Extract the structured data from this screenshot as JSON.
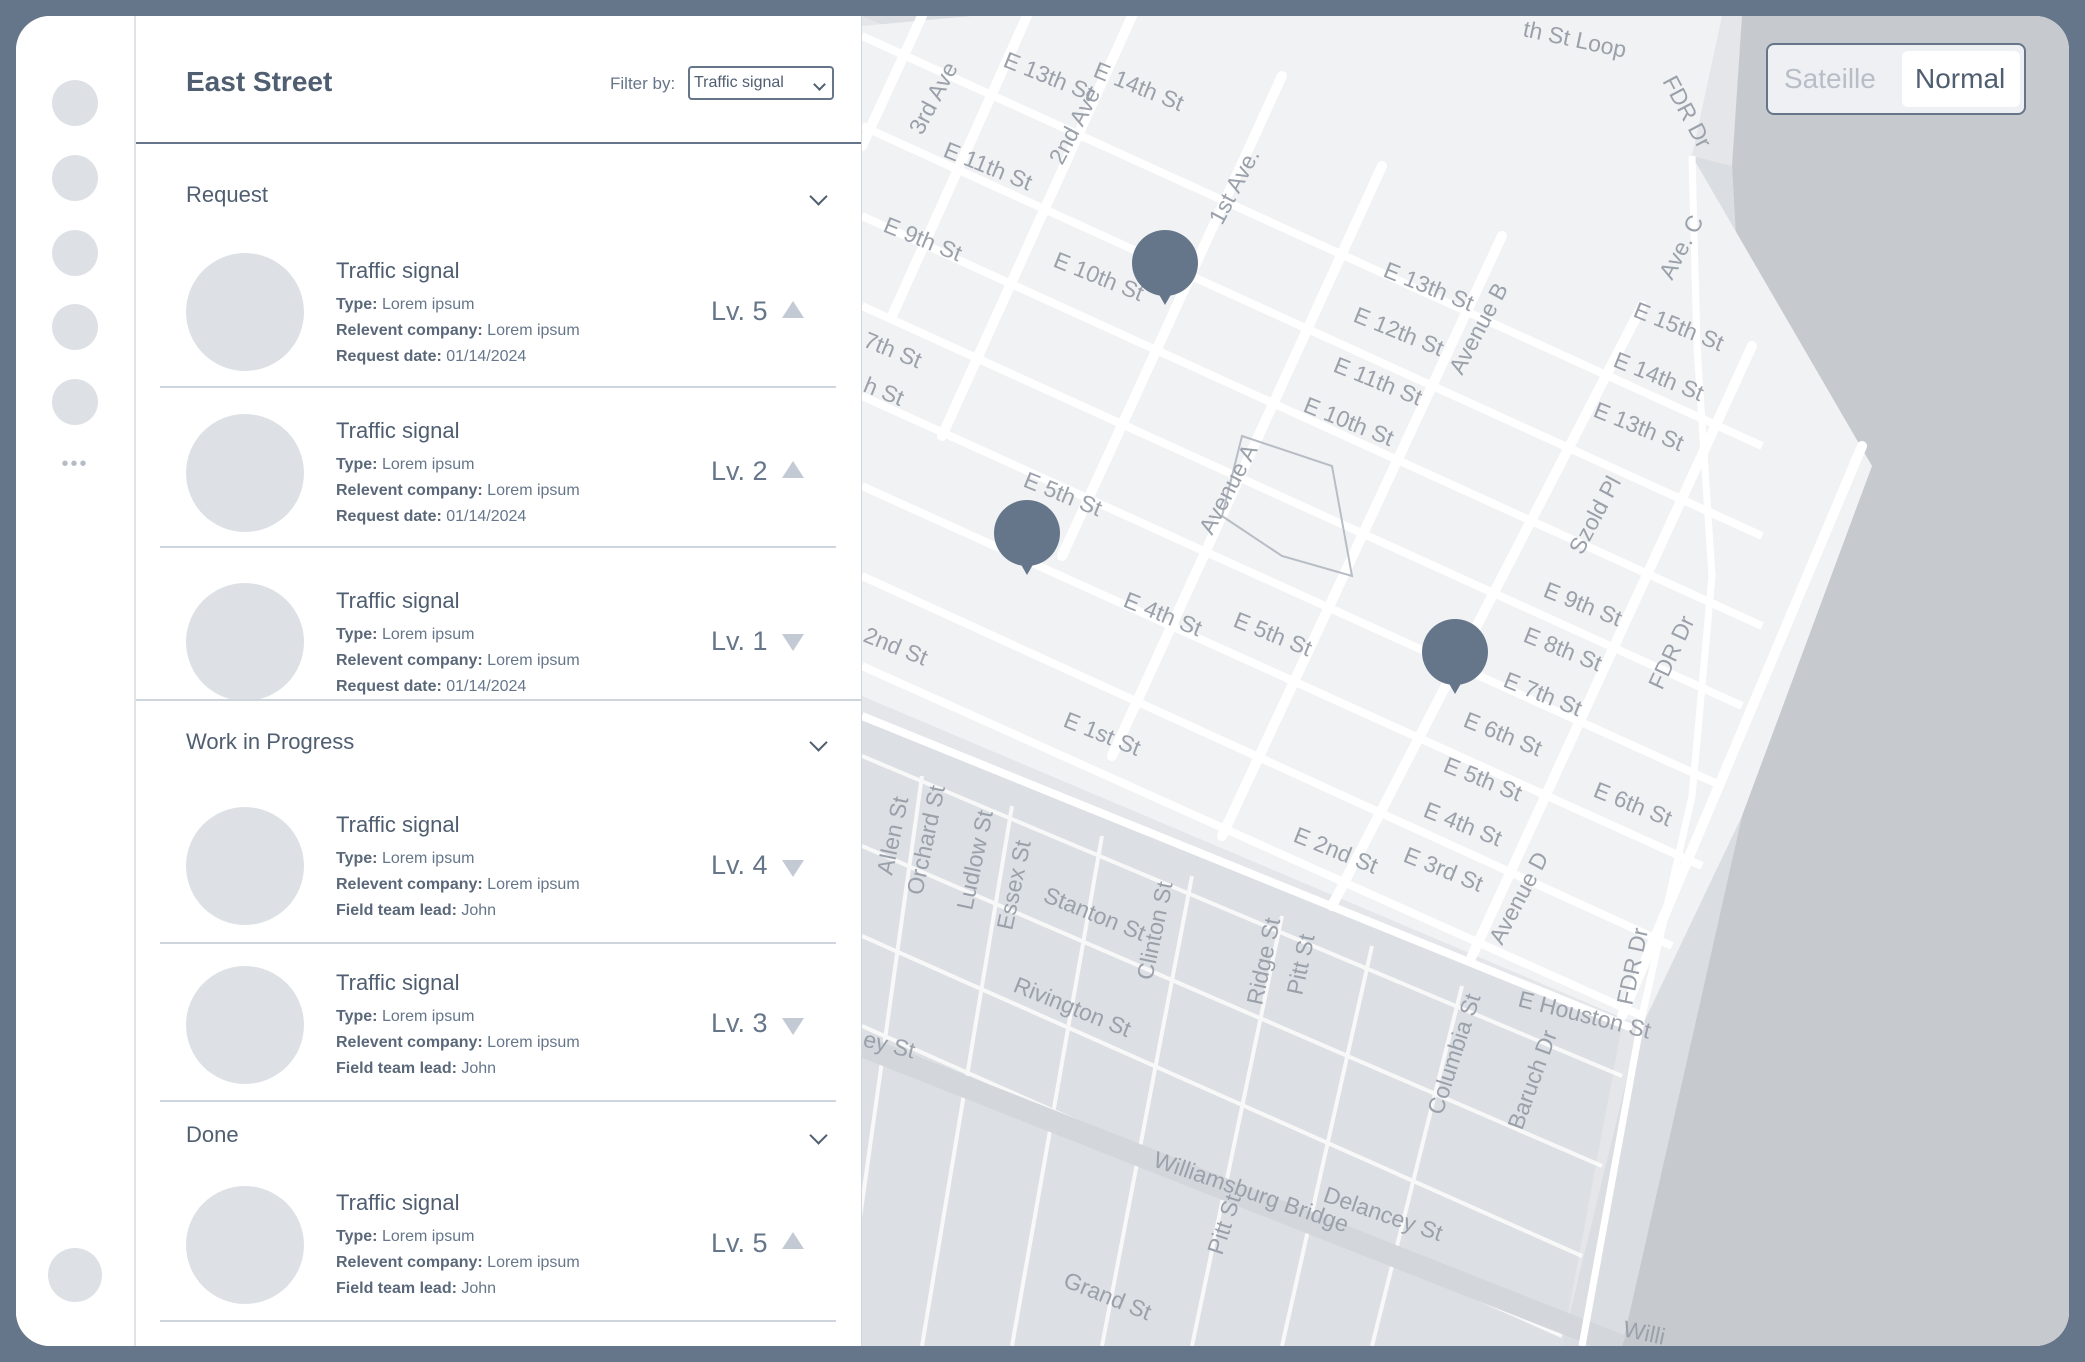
{
  "header": {
    "title": "East Street",
    "filter_label": "Filter by:",
    "filter_value": "Traffic signal"
  },
  "sections": [
    {
      "title": "Request",
      "items": [
        {
          "title": "Traffic signal",
          "type_label": "Type:",
          "type_value": "Lorem ipsum",
          "company_label": "Relevent company:",
          "company_value": "Lorem ipsum",
          "extra_label": "Request date:",
          "extra_value": "01/14/2024",
          "level": "Lv. 5",
          "trend": "up"
        },
        {
          "title": "Traffic signal",
          "type_label": "Type:",
          "type_value": "Lorem ipsum",
          "company_label": "Relevent company:",
          "company_value": "Lorem ipsum",
          "extra_label": "Request date:",
          "extra_value": "01/14/2024",
          "level": "Lv. 2",
          "trend": "up"
        },
        {
          "title": "Traffic signal",
          "type_label": "Type:",
          "type_value": "Lorem ipsum",
          "company_label": "Relevent company:",
          "company_value": "Lorem ipsum",
          "extra_label": "Request date:",
          "extra_value": "01/14/2024",
          "level": "Lv. 1",
          "trend": "down"
        }
      ]
    },
    {
      "title": "Work in Progress",
      "items": [
        {
          "title": "Traffic signal",
          "type_label": "Type:",
          "type_value": "Lorem ipsum",
          "company_label": "Relevent company:",
          "company_value": "Lorem ipsum",
          "extra_label": "Field team lead:",
          "extra_value": "John",
          "level": "Lv. 4",
          "trend": "down"
        },
        {
          "title": "Traffic signal",
          "type_label": "Type:",
          "type_value": "Lorem ipsum",
          "company_label": "Relevent company:",
          "company_value": "Lorem ipsum",
          "extra_label": "Field team lead:",
          "extra_value": "John",
          "level": "Lv. 3",
          "trend": "down"
        }
      ]
    },
    {
      "title": "Done",
      "items": [
        {
          "title": "Traffic signal",
          "type_label": "Type:",
          "type_value": "Lorem ipsum",
          "company_label": "Relevent company:",
          "company_value": "Lorem ipsum",
          "extra_label": "Field team lead:",
          "extra_value": "John",
          "level": "Lv. 5",
          "trend": "up"
        }
      ]
    }
  ],
  "map": {
    "view_toggle": {
      "satellite": "Sateille",
      "normal": "Normal",
      "selected": "Normal"
    },
    "streets": [
      "E 14th St",
      "E 13th St",
      "E 11th St",
      "3rd Ave",
      "2nd Ave",
      "1st Ave.",
      "E 9th St",
      "E 10th St",
      "E 12th St",
      "E 13th St",
      "Avenue B",
      "E 11th St",
      "E 10th St",
      "E 15th St",
      "E 14th St",
      "E 13th St",
      "Ave. C",
      "FDR Dr",
      "E 5th St",
      "E 4th St",
      "E 5th St",
      "Avenue A",
      "Szold Pl",
      "E 9th St",
      "E 8th St",
      "E 7th St",
      "E 6th St",
      "E 5th St",
      "E 4th St",
      "E 3rd St",
      "E 2nd St",
      "E 6th St",
      "E 1st St",
      "2nd St",
      "Allen St",
      "Orchard St",
      "Ludlow St",
      "Essex St",
      "Stanton St",
      "Clinton St",
      "Ridge St",
      "Pitt St",
      "Rivington St",
      "Columbia St",
      "Avenue D",
      "E Houston St",
      "FDR Dr",
      "FDR Dr",
      "Baruch Dr",
      "Williamsburg Bridge",
      "Delancey St",
      "Pitt St",
      "Grand St",
      "ey St",
      "7th St",
      "h St",
      "th St Loop",
      "Willi"
    ],
    "pin_color": "#66768a"
  },
  "colors": {
    "frame": "#66768a",
    "text": "#4f5e70",
    "placeholder": "#dde1e6",
    "map_bg": "#e4e6e9",
    "water": "#c6c9ce"
  }
}
